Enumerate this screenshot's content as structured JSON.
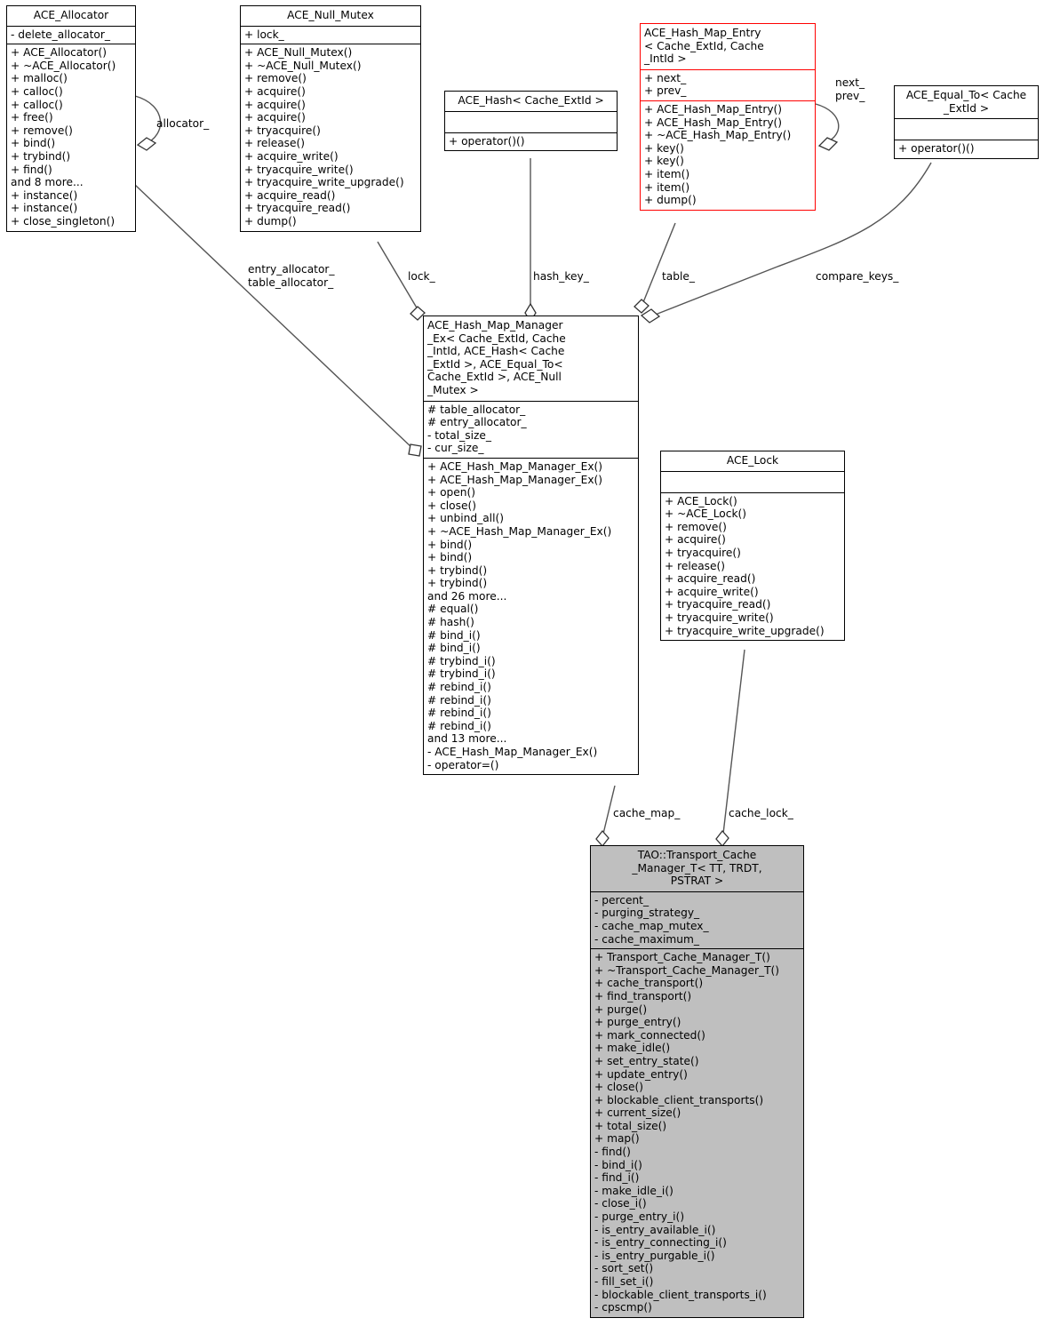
{
  "diagram": {
    "type": "uml-class-diagram",
    "title": "TAO::Transport_Cache_Manager_T collaboration diagram",
    "colors": {
      "highlight_border": "#ff0000",
      "default_border": "#000000",
      "focus_fill": "#bfbfbf",
      "default_fill": "#ffffff",
      "edge": "#555555"
    }
  },
  "classes": [
    {
      "id": "ace_allocator",
      "name": "ACE_Allocator",
      "attributes": [
        "- delete_allocator_"
      ],
      "operations": [
        "+ ACE_Allocator()",
        "+ ~ACE_Allocator()",
        "+ malloc()",
        "+ calloc()",
        "+ calloc()",
        "+ free()",
        "+ remove()",
        "+ bind()",
        "+ trybind()",
        "+ find()",
        "and 8 more...",
        "+ instance()",
        "+ instance()",
        "+ close_singleton()"
      ]
    },
    {
      "id": "ace_null_mutex",
      "name": "ACE_Null_Mutex",
      "attributes": [
        "+ lock_"
      ],
      "operations": [
        "+ ACE_Null_Mutex()",
        "+ ~ACE_Null_Mutex()",
        "+ remove()",
        "+ acquire()",
        "+ acquire()",
        "+ acquire()",
        "+ tryacquire()",
        "+ release()",
        "+ acquire_write()",
        "+ tryacquire_write()",
        "+ tryacquire_write_upgrade()",
        "+ acquire_read()",
        "+ tryacquire_read()",
        "+ dump()"
      ]
    },
    {
      "id": "ace_hash",
      "name": "ACE_Hash< Cache_ExtId >",
      "attributes": [],
      "operations": [
        "+ operator()()"
      ]
    },
    {
      "id": "ace_hash_map_entry",
      "name": "ACE_Hash_Map_Entry\n< Cache_ExtId, Cache\n_IntId >",
      "attributes": [
        "+ next_",
        "+ prev_"
      ],
      "operations": [
        "+ ACE_Hash_Map_Entry()",
        "+ ACE_Hash_Map_Entry()",
        "+ ~ACE_Hash_Map_Entry()",
        "+ key()",
        "+ key()",
        "+ item()",
        "+ item()",
        "+ dump()"
      ]
    },
    {
      "id": "ace_equal_to",
      "name": "ACE_Equal_To< Cache\n_ExtId >",
      "attributes": [],
      "operations": [
        "+ operator()()"
      ]
    },
    {
      "id": "ace_hash_map_manager_ex",
      "name": "ACE_Hash_Map_Manager\n_Ex< Cache_ExtId, Cache\n_IntId, ACE_Hash< Cache\n_ExtId >, ACE_Equal_To<\n Cache_ExtId >, ACE_Null\n_Mutex >",
      "attributes": [
        "# table_allocator_",
        "# entry_allocator_",
        "- total_size_",
        "- cur_size_"
      ],
      "operations": [
        "+ ACE_Hash_Map_Manager_Ex()",
        "+ ACE_Hash_Map_Manager_Ex()",
        "+ open()",
        "+ close()",
        "+ unbind_all()",
        "+ ~ACE_Hash_Map_Manager_Ex()",
        "+ bind()",
        "+ bind()",
        "+ trybind()",
        "+ trybind()",
        "and 26 more...",
        "# equal()",
        "# hash()",
        "# bind_i()",
        "# bind_i()",
        "# trybind_i()",
        "# trybind_i()",
        "# rebind_i()",
        "# rebind_i()",
        "# rebind_i()",
        "# rebind_i()",
        "and 13 more...",
        "- ACE_Hash_Map_Manager_Ex()",
        "- operator=()"
      ]
    },
    {
      "id": "ace_lock",
      "name": "ACE_Lock",
      "attributes": [],
      "operations": [
        "+ ACE_Lock()",
        "+ ~ACE_Lock()",
        "+ remove()",
        "+ acquire()",
        "+ tryacquire()",
        "+ release()",
        "+ acquire_read()",
        "+ acquire_write()",
        "+ tryacquire_read()",
        "+ tryacquire_write()",
        "+ tryacquire_write_upgrade()"
      ]
    },
    {
      "id": "tao_transport_cache_manager_t",
      "name": "TAO::Transport_Cache\n_Manager_T< TT, TRDT,\nPSTRAT >",
      "attributes": [
        "- percent_",
        "- purging_strategy_",
        "- cache_map_mutex_",
        "- cache_maximum_"
      ],
      "operations": [
        "+ Transport_Cache_Manager_T()",
        "+ ~Transport_Cache_Manager_T()",
        "+ cache_transport()",
        "+ find_transport()",
        "+ purge()",
        "+ purge_entry()",
        "+ mark_connected()",
        "+ make_idle()",
        "+ set_entry_state()",
        "+ update_entry()",
        "+ close()",
        "+ blockable_client_transports()",
        "+ current_size()",
        "+ total_size()",
        "+ map()",
        "- find()",
        "- bind_i()",
        "- find_i()",
        "- make_idle_i()",
        "- close_i()",
        "- purge_entry_i()",
        "- is_entry_available_i()",
        "- is_entry_connecting_i()",
        "- is_entry_purgable_i()",
        "- sort_set()",
        "- fill_set_i()",
        "- blockable_client_transports_i()",
        "- cpscmp()"
      ]
    }
  ],
  "edge_labels": {
    "allocator": "allocator_",
    "entry_table_allocator": "entry_allocator_\ntable_allocator_",
    "lock": "lock_",
    "hash_key": "hash_key_",
    "table": "table_",
    "next_prev": "next_\nprev_",
    "compare_keys": "compare_keys_",
    "cache_map": "cache_map_",
    "cache_lock": "cache_lock_"
  }
}
